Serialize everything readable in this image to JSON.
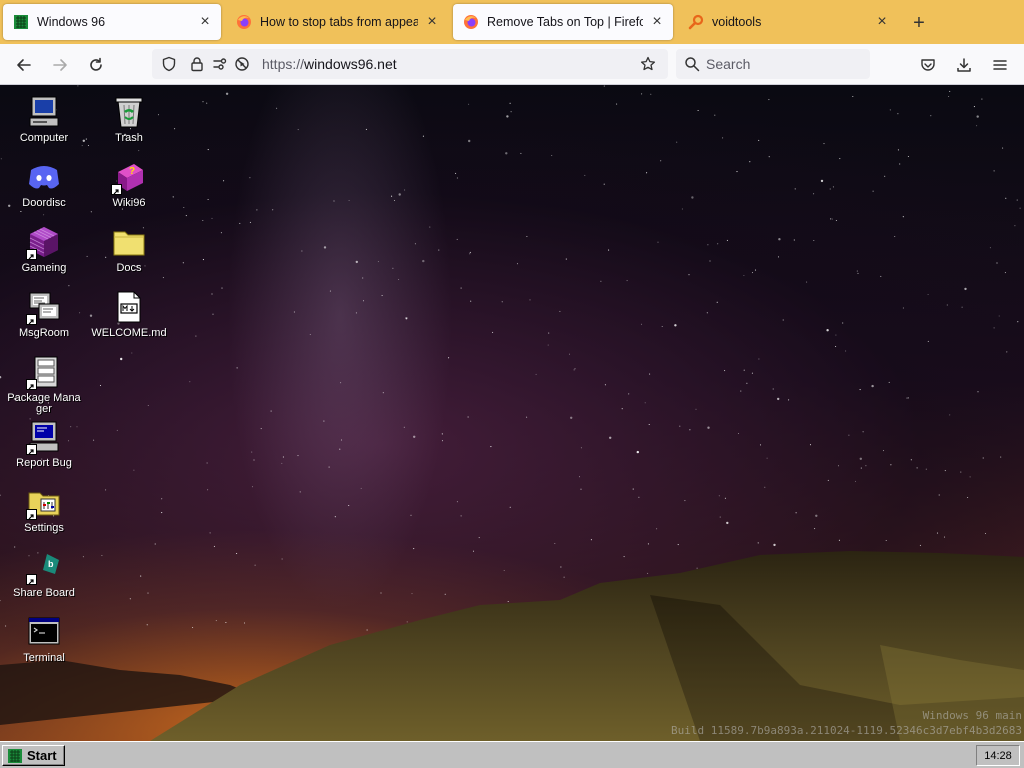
{
  "browser": {
    "tabs": [
      {
        "title": "Windows 96",
        "active": true,
        "icon": "windows96-logo-icon"
      },
      {
        "title": "How to stop tabs from appear",
        "active": false,
        "icon": "firefox-icon"
      },
      {
        "title": "Remove Tabs on Top | Firefox Su",
        "active": true,
        "icon": "firefox-icon"
      },
      {
        "title": "voidtools",
        "active": false,
        "icon": "search-magnifier-icon"
      }
    ],
    "new_tab_label": "+",
    "url": {
      "protocol": "https://",
      "host": "windows96.net"
    },
    "search_placeholder": "Search",
    "colors": {
      "tabbar": "#f0c15a",
      "toolbar": "#f9f9fb"
    }
  },
  "desktop": {
    "icons": [
      {
        "label": "Computer"
      },
      {
        "label": "Trash"
      },
      {
        "label": "Doordisc"
      },
      {
        "label": "Wiki96"
      },
      {
        "label": "Gameing"
      },
      {
        "label": "Docs"
      },
      {
        "label": "MsgRoom"
      },
      {
        "label": "WELCOME.md"
      },
      {
        "label": "Package Manager"
      },
      {
        "label": "Report Bug"
      },
      {
        "label": "Settings"
      },
      {
        "label": "Share Board"
      },
      {
        "label": "Terminal"
      }
    ],
    "build_line1": "Windows 96 main",
    "build_line2": "Build 11589.7b9a893a.211024-1119.52346c3d7ebf4b3d2683"
  },
  "taskbar": {
    "start_label": "Start",
    "clock": "14:28"
  }
}
